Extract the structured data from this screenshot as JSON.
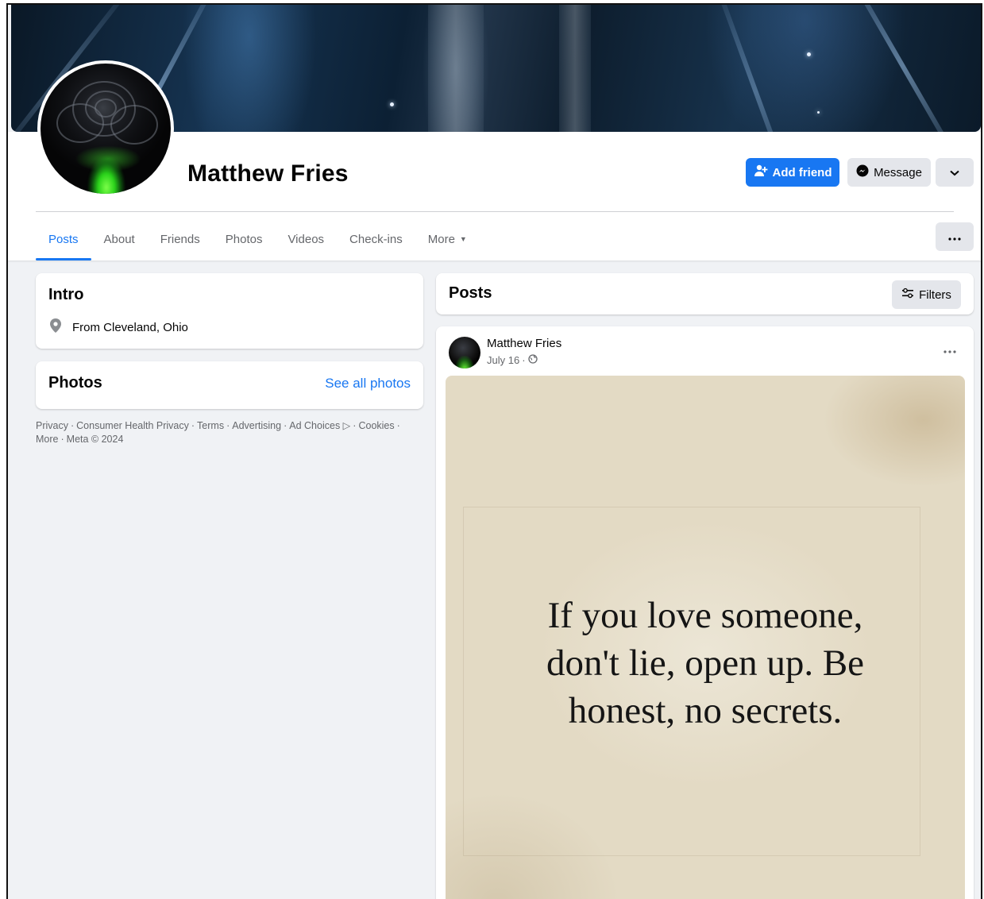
{
  "profile": {
    "name": "Matthew Fries"
  },
  "actions": {
    "add_friend": "Add friend",
    "message": "Message"
  },
  "tabs": [
    {
      "label": "Posts",
      "active": true
    },
    {
      "label": "About"
    },
    {
      "label": "Friends"
    },
    {
      "label": "Photos"
    },
    {
      "label": "Videos"
    },
    {
      "label": "Check-ins"
    },
    {
      "label": "More"
    }
  ],
  "intro": {
    "title": "Intro",
    "location": "From Cleveland, Ohio"
  },
  "photos": {
    "title": "Photos",
    "see_all": "See all photos"
  },
  "footer": {
    "links": [
      "Privacy",
      "Consumer Health Privacy",
      "Terms",
      "Advertising",
      "Ad Choices",
      "Cookies",
      "More"
    ],
    "copyright": "Meta © 2024"
  },
  "posts_section": {
    "title": "Posts",
    "filters": "Filters"
  },
  "post": {
    "author": "Matthew Fries",
    "date": "July 16",
    "separator": "·",
    "quote_lines": [
      "If you love someone,",
      "don't lie, open up. Be",
      "honest, no secrets."
    ]
  },
  "colors": {
    "accent": "#1877f2",
    "background": "#f0f2f5",
    "secondary_button": "#e4e6eb",
    "muted_text": "#65676b"
  },
  "icons": {
    "add_friend": "person-plus-icon",
    "message": "messenger-icon",
    "chevron": "chevron-down-icon",
    "more": "ellipsis-icon",
    "location": "map-pin-icon",
    "filters": "sliders-icon",
    "audience": "globe-icon",
    "ad_choices": "ad-choices-icon"
  }
}
